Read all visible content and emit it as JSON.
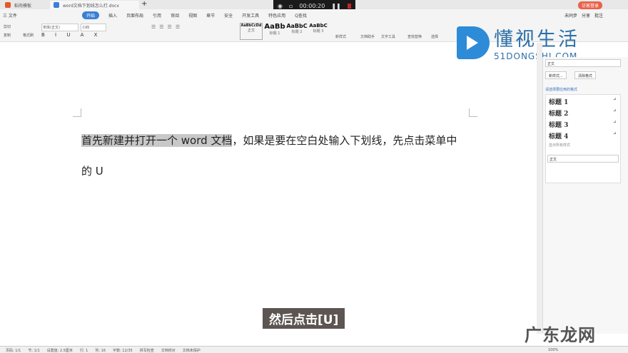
{
  "tabs": [
    {
      "label": "稻壳模板"
    },
    {
      "label": "word文档下划线怎么打.docx"
    }
  ],
  "recorder": {
    "time": "00:00:20"
  },
  "menu": [
    "三 文件",
    "开始",
    "插入",
    "页面布局",
    "引用",
    "审阅",
    "视图",
    "章节",
    "安全",
    "开发工具",
    "特色应用",
    "Q查找"
  ],
  "top_right": {
    "login": "访客登录",
    "sync": "未同步",
    "share": "分享",
    "comment": "批注"
  },
  "ribbon": {
    "cut": "剪切",
    "paste": "粘贴",
    "copy": "复制",
    "format_painter": "格式刷",
    "font": "宋体(正文)",
    "size": "小四",
    "styles": [
      {
        "preview": "AaBbCcDd",
        "label": "正文"
      },
      {
        "preview": "AaBb",
        "label": "标题 1"
      },
      {
        "preview": "AaBbC",
        "label": "标题 2"
      },
      {
        "preview": "AaBbC",
        "label": "标题 3"
      }
    ],
    "new_style": "新样式",
    "doc_helper": "文档助手",
    "text_tool": "文字工具",
    "find_replace": "查找替换",
    "select": "选择"
  },
  "logo": {
    "cn": "懂视生活",
    "en": "51DONGSHI.COM"
  },
  "document": {
    "selected": "首先新建并打开一个 word 文档",
    "rest": "，如果是要在空白处输入下划线，先点击菜单中",
    "line2": "的 U"
  },
  "sidebar": {
    "current": "正文",
    "new_style": "新样式...",
    "clear": "清除格式",
    "heading": "请选择要应用的格式",
    "styles": [
      "标题 1",
      "标题 2",
      "标题 3",
      "标题 4"
    ],
    "show": "显示所有样式",
    "filter": "正文"
  },
  "subtitle": "然后点击[U]",
  "watermark": "广东龙网",
  "status": [
    "页码: 1/1",
    "节: 1/1",
    "设置值: 2.5厘米",
    "行: 1",
    "列: 16",
    "字数: 12/35",
    "拼写检查",
    "文档校对",
    "文档未保护"
  ],
  "zoom": "100%"
}
